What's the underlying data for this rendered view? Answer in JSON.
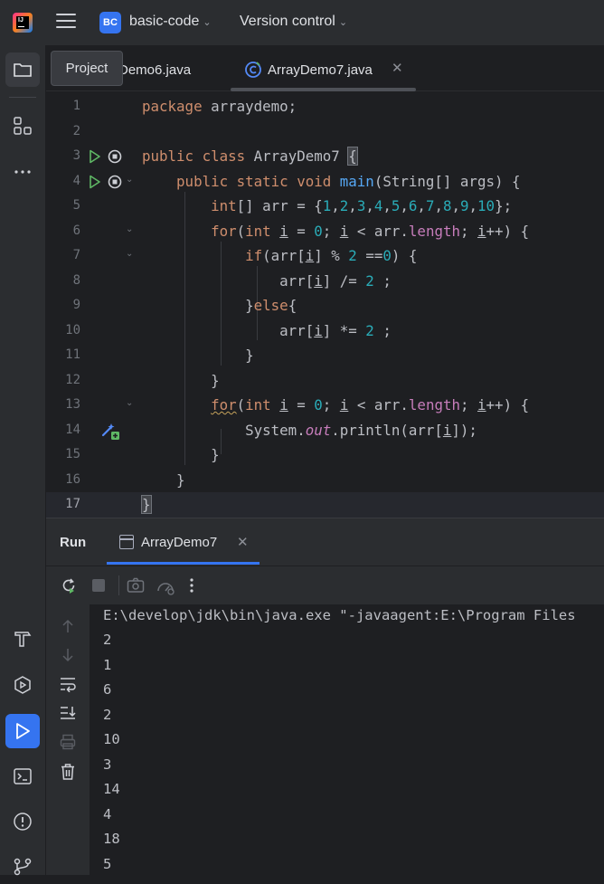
{
  "topbar": {
    "logo_text": "IJ",
    "project_badge": "BC",
    "project_name": "basic-code",
    "vcs_label": "Version control"
  },
  "tooltip": "Project",
  "tabs": [
    {
      "label": "Demo6.java",
      "visible_label": "Demo6.java"
    },
    {
      "label": "ArrayDemo7.java",
      "active": true
    }
  ],
  "editor": {
    "current_line": 17,
    "line_numbers": [
      "1",
      "2",
      "3",
      "4",
      "5",
      "6",
      "7",
      "8",
      "9",
      "10",
      "11",
      "12",
      "13",
      "14",
      "15",
      "16",
      "17"
    ],
    "lines": [
      "package arraydemo;",
      "",
      "public class ArrayDemo7 {",
      "    public static void main(String[] args) {",
      "        int[] arr = {1,2,3,4,5,6,7,8,9,10};",
      "        for(int i = 0; i < arr.length; i++) {",
      "            if(arr[i] % 2 ==0) {",
      "                arr[i] /= 2 ;",
      "            }else{",
      "                arr[i] *= 2 ;",
      "            }",
      "        }",
      "        for(int i = 0; i < arr.length; i++) {",
      "            System.out.println(arr[i]);",
      "        }",
      "    }",
      "}"
    ]
  },
  "run_panel": {
    "title": "Run",
    "tab_label": "ArrayDemo7",
    "command": "E:\\develop\\jdk\\bin\\java.exe \"-javaagent:E:\\Program Files",
    "output": [
      "2",
      "1",
      "6",
      "2",
      "10",
      "3",
      "14",
      "4",
      "18",
      "5"
    ]
  },
  "colors": {
    "accent": "#3574f0",
    "keyword": "#cf8e6d",
    "number": "#2aacb8",
    "method": "#56a8f5",
    "field": "#c77dbb",
    "run_green": "#5fb865"
  },
  "icons": {
    "left_toolbar": [
      "folder-icon",
      "structure-icon",
      "more-icon",
      "build-icon",
      "services-icon",
      "run-icon",
      "terminal-icon",
      "problems-icon",
      "git-icon"
    ],
    "run_toolbar": [
      "rerun-icon",
      "stop-icon",
      "camera-icon",
      "profiler-icon",
      "kebab-menu-icon"
    ],
    "run_side": [
      "scroll-up-icon",
      "scroll-down-icon",
      "soft-wrap-icon",
      "scroll-to-end-icon",
      "print-icon",
      "trash-icon"
    ]
  }
}
